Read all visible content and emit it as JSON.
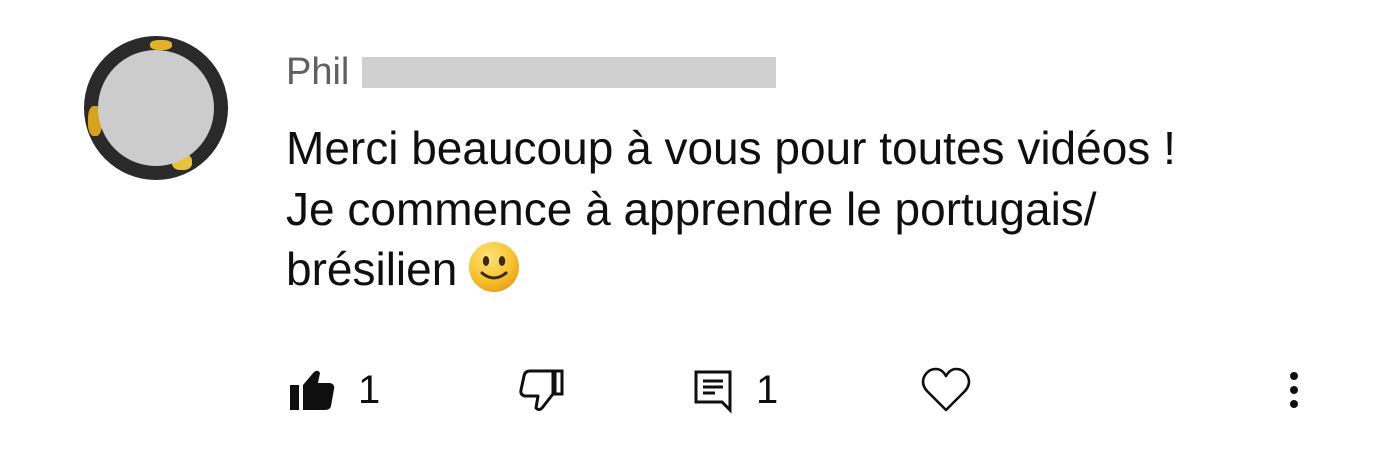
{
  "comment": {
    "author": "Phil",
    "text_lines": [
      "Merci beaucoup à vous pour toutes vidéos !",
      "Je commence à apprendre le portugais/",
      "brésilien"
    ],
    "emoji": "slightly-smiling-face"
  },
  "actions": {
    "like_count": "1",
    "reply_count": "1"
  },
  "icons": {
    "like": "thumbs-up-filled-icon",
    "dislike": "thumbs-down-outline-icon",
    "reply": "comment-reply-icon",
    "heart": "heart-outline-icon",
    "more": "more-vertical-icon"
  },
  "colors": {
    "text": "#0f0f0f",
    "secondary_text": "#606060",
    "redaction": "#d0d0d0",
    "emoji": "#f7c531"
  }
}
